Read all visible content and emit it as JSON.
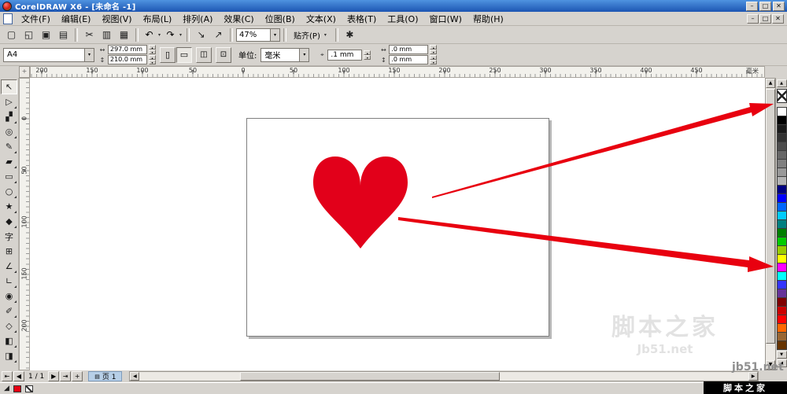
{
  "window": {
    "title": "CorelDRAW X6 - [未命名 -1]"
  },
  "icons": {
    "minimize": "–",
    "maximize": "□",
    "close": "✕",
    "chevron_down": "▾",
    "spin_up": "▴",
    "spin_down": "▾",
    "scroll_up": "▲",
    "scroll_down": "▼",
    "scroll_left": "◀",
    "scroll_right": "▶",
    "flyout_left": "◀",
    "first_page": "⇤",
    "prev_page": "◀",
    "next_page": "▶",
    "last_page": "⇥",
    "add_page": "+",
    "page_tab": "▤",
    "width_arrow": "↔",
    "height_arrow": "↕",
    "portrait": "▯",
    "landscape": "▭",
    "pages_all": "◫",
    "pages_one": "⊡",
    "nudge": "⌖",
    "ruler_origin": "+",
    "status_cursor": "◢",
    "doc_min": "–",
    "doc_restore": "□",
    "doc_close": "✕"
  },
  "menu": {
    "items": [
      {
        "name": "menu-file",
        "label": "文件(F)"
      },
      {
        "name": "menu-edit",
        "label": "编辑(E)"
      },
      {
        "name": "menu-view",
        "label": "视图(V)"
      },
      {
        "name": "menu-layout",
        "label": "布局(L)"
      },
      {
        "name": "menu-arrange",
        "label": "排列(A)"
      },
      {
        "name": "menu-effects",
        "label": "效果(C)"
      },
      {
        "name": "menu-bitmaps",
        "label": "位图(B)"
      },
      {
        "name": "menu-text",
        "label": "文本(X)"
      },
      {
        "name": "menu-table",
        "label": "表格(T)"
      },
      {
        "name": "menu-tools",
        "label": "工具(O)"
      },
      {
        "name": "menu-window",
        "label": "窗口(W)"
      },
      {
        "name": "menu-help",
        "label": "帮助(H)"
      }
    ]
  },
  "std_toolbar": {
    "items": [
      {
        "kind": "btn",
        "name": "new-button",
        "glyph": "▢"
      },
      {
        "kind": "btn",
        "name": "open-button",
        "glyph": "◱"
      },
      {
        "kind": "btn",
        "name": "save-button",
        "glyph": "▣"
      },
      {
        "kind": "btn",
        "name": "print-button",
        "glyph": "▤"
      },
      {
        "kind": "sep"
      },
      {
        "kind": "btn",
        "name": "cut-button",
        "glyph": "✂"
      },
      {
        "kind": "btn",
        "name": "copy-button",
        "glyph": "▥"
      },
      {
        "kind": "btn",
        "name": "paste-button",
        "glyph": "▦"
      },
      {
        "kind": "sep"
      },
      {
        "kind": "ddbtn",
        "name": "undo-button",
        "glyph": "↶"
      },
      {
        "kind": "ddbtn",
        "name": "redo-button",
        "glyph": "↷"
      },
      {
        "kind": "sep"
      },
      {
        "kind": "btn",
        "name": "import-button",
        "glyph": "↘"
      },
      {
        "kind": "btn",
        "name": "export-button",
        "glyph": "↗"
      },
      {
        "kind": "sep"
      },
      {
        "kind": "dd",
        "name": "zoom-level-select",
        "label": "47%",
        "width": 56
      },
      {
        "kind": "sep"
      },
      {
        "kind": "menubtn",
        "name": "snap-menu-button",
        "label": "贴齐(P)"
      },
      {
        "kind": "sep"
      },
      {
        "kind": "btn",
        "name": "options-button",
        "glyph": "✱"
      }
    ]
  },
  "property_bar": {
    "paper_size": "A4",
    "page_width": "297.0 mm",
    "page_height": "210.0 mm",
    "units_label": "单位:",
    "units": "毫米",
    "nudge_offset": ".1 mm",
    "duplicate_x": ".0 mm",
    "duplicate_y": ".0 mm"
  },
  "rulers": {
    "h_labels": [
      "200",
      "150",
      "100",
      "50",
      "0",
      "50",
      "100",
      "150",
      "200",
      "250",
      "300",
      "350",
      "400",
      "450"
    ],
    "unit": "毫米",
    "v_labels": [
      "0",
      "50",
      "100",
      "150",
      "200"
    ]
  },
  "toolbox": {
    "tools": [
      {
        "name": "pick-tool",
        "glyph": "↖",
        "selected": true
      },
      {
        "name": "shape-tool",
        "glyph": "▷",
        "flyout": true
      },
      {
        "name": "crop-tool",
        "glyph": "▞",
        "flyout": true
      },
      {
        "name": "zoom-tool",
        "glyph": "◎",
        "flyout": true
      },
      {
        "name": "freehand-tool",
        "glyph": "✎",
        "flyout": true
      },
      {
        "name": "smart-fill-tool",
        "glyph": "▰",
        "flyout": true
      },
      {
        "name": "rectangle-tool",
        "glyph": "▭",
        "flyout": true
      },
      {
        "name": "ellipse-tool",
        "glyph": "○",
        "flyout": true
      },
      {
        "name": "polygon-tool",
        "glyph": "★",
        "flyout": true
      },
      {
        "name": "basic-shapes-tool",
        "glyph": "◆",
        "flyout": true
      },
      {
        "name": "text-tool",
        "glyph": "字"
      },
      {
        "name": "table-tool",
        "glyph": "⊞"
      },
      {
        "name": "dimension-tool",
        "glyph": "∠",
        "flyout": true
      },
      {
        "name": "connector-tool",
        "glyph": "∟",
        "flyout": true
      },
      {
        "name": "blend-tool",
        "glyph": "◉",
        "flyout": true
      },
      {
        "name": "eyedropper-tool",
        "glyph": "✐",
        "flyout": true
      },
      {
        "name": "outline-pen-tool",
        "glyph": "◇",
        "flyout": true
      },
      {
        "name": "fill-tool",
        "glyph": "◧",
        "flyout": true
      },
      {
        "name": "interactive-fill-tool",
        "glyph": "◨",
        "flyout": true
      }
    ]
  },
  "palette": {
    "swatches": [
      "#FFFFFF",
      "#000000",
      "#1A1A1A",
      "#333333",
      "#4D4D4D",
      "#666666",
      "#808080",
      "#999999",
      "#B3B3B3",
      "#000080",
      "#0000FF",
      "#0066FF",
      "#00CCFF",
      "#008080",
      "#008000",
      "#00CC00",
      "#99CC00",
      "#FFFF00",
      "#FF00FF",
      "#00FFFF",
      "#3333FF",
      "#663399",
      "#800000",
      "#CC0000",
      "#FF0000",
      "#FF6600",
      "#996633",
      "#663300"
    ]
  },
  "pagebar": {
    "page_info": "1 / 1",
    "page_tab": "页 1"
  },
  "statusbar": {
    "fill_color": "#e60012"
  },
  "canvas": {
    "heart_color": "#e2001a",
    "arrow_color": "#e8000f"
  },
  "watermark": {
    "site": "jb51.net",
    "brand": "脚本之家",
    "ghost_site": "Jb51.net"
  }
}
